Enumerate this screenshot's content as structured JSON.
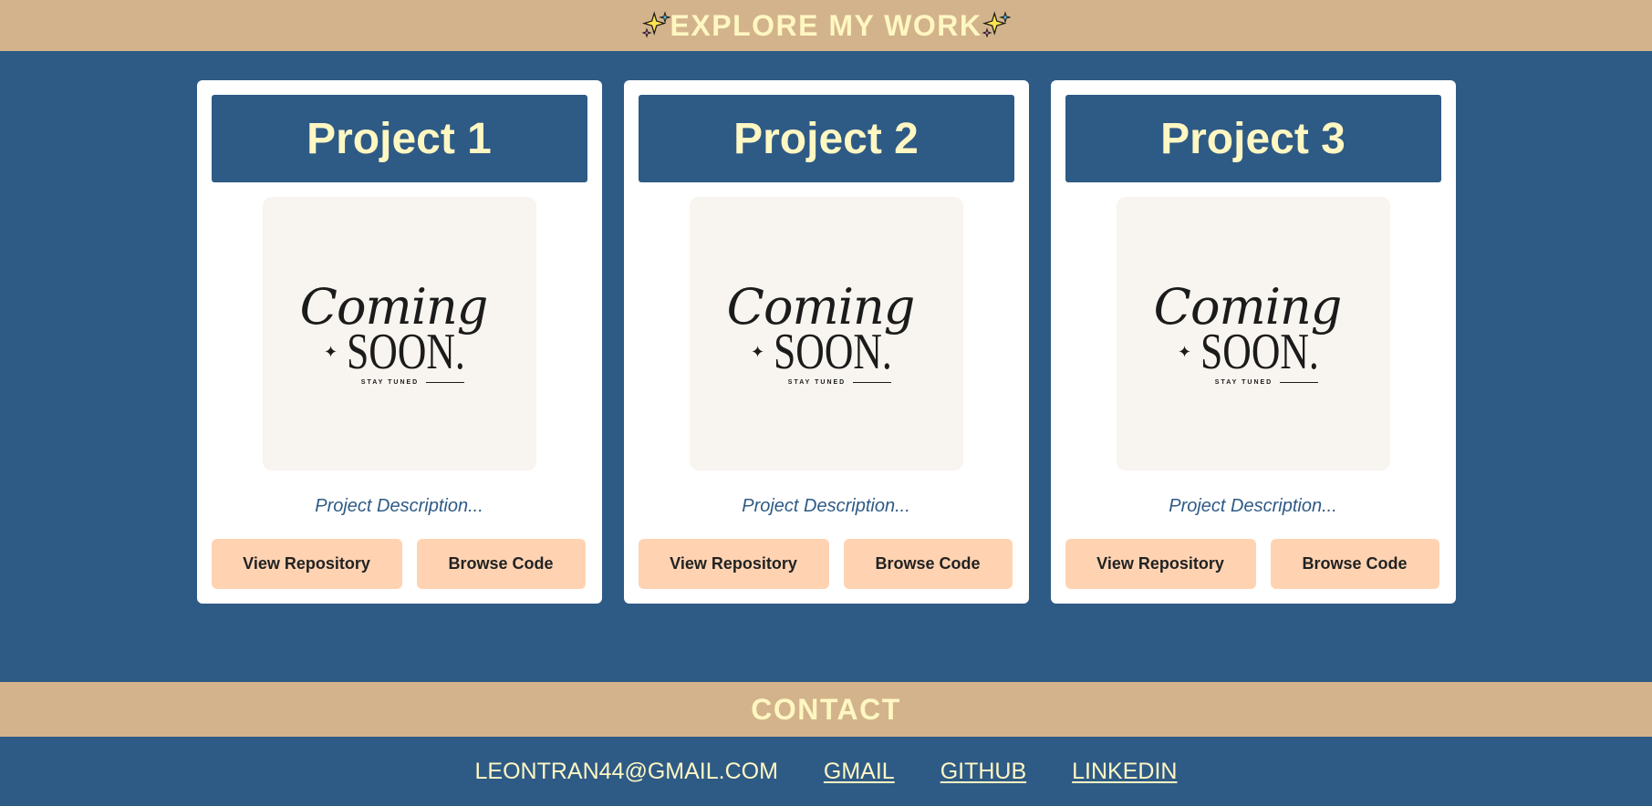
{
  "header": {
    "title": "EXPLORE MY WORK",
    "left_icon": "sparkles-icon",
    "right_icon": "sparkles-icon"
  },
  "projects": [
    {
      "title": "Project 1",
      "image": {
        "coming": "Coming",
        "soon": "SOON.",
        "tagline": "STAY TUNED"
      },
      "description": "Project Description...",
      "repo_label": "View Repository",
      "code_label": "Browse Code"
    },
    {
      "title": "Project 2",
      "image": {
        "coming": "Coming",
        "soon": "SOON.",
        "tagline": "STAY TUNED"
      },
      "description": "Project Description...",
      "repo_label": "View Repository",
      "code_label": "Browse Code"
    },
    {
      "title": "Project 3",
      "image": {
        "coming": "Coming",
        "soon": "SOON.",
        "tagline": "STAY TUNED"
      },
      "description": "Project Description...",
      "repo_label": "View Repository",
      "code_label": "Browse Code"
    }
  ],
  "contact": {
    "title": "CONTACT",
    "email": "LEONTRAN44@GMAIL.COM",
    "links": [
      "GMAIL",
      "GITHUB",
      "LINKEDIN"
    ]
  },
  "colors": {
    "background": "#2e5a86",
    "banner": "#d3b38b",
    "accent_text": "#fff7c2",
    "button": "#ffd3b2",
    "card": "#ffffff"
  }
}
